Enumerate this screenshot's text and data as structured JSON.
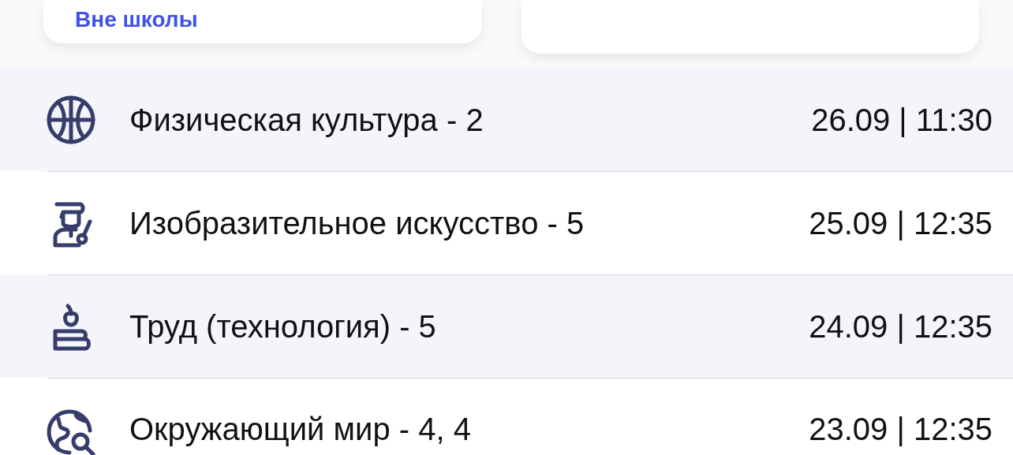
{
  "outside_link": "Вне школы",
  "grades": [
    {
      "kind": "basketball",
      "subject": "Физическая культура - 2",
      "datetime": "26.09 | 11:30"
    },
    {
      "kind": "painter",
      "subject": "Изобразительное искусство - 5",
      "datetime": "25.09 | 12:35"
    },
    {
      "kind": "books",
      "subject": "Труд (технология) - 5",
      "datetime": "24.09 | 12:35"
    },
    {
      "kind": "globe",
      "subject": "Окружающий мир - 4, 4",
      "datetime": "23.09 | 12:35"
    }
  ]
}
